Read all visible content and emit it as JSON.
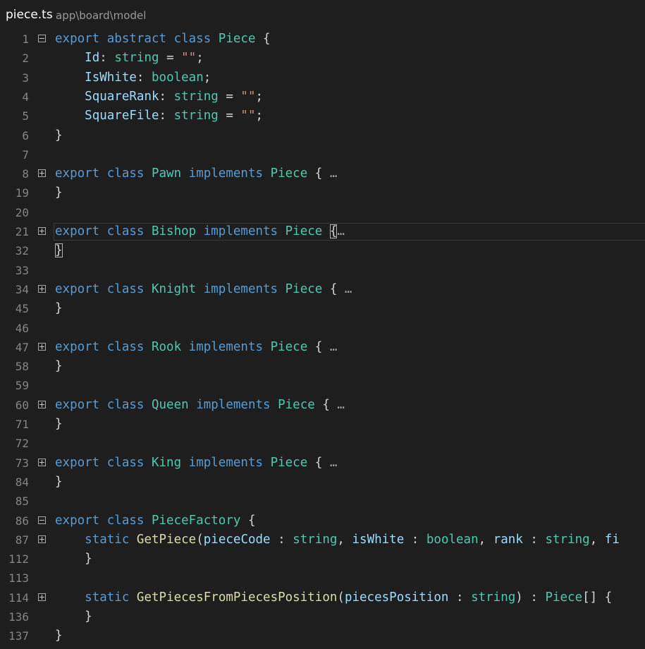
{
  "tab": {
    "file_name": "piece.ts",
    "path": "app\\board\\model"
  },
  "editor": {
    "lines": [
      {
        "num": "1",
        "fold": "minus",
        "tokens": [
          [
            "k",
            "export abstract class "
          ],
          [
            "t",
            "Piece"
          ],
          [
            "o",
            " {"
          ]
        ]
      },
      {
        "num": "2",
        "tokens": [
          [
            "o",
            "    "
          ],
          [
            "p",
            "Id"
          ],
          [
            "o",
            ": "
          ],
          [
            "t",
            "string"
          ],
          [
            "o",
            " = "
          ],
          [
            "s",
            "\"\""
          ],
          [
            "o",
            ";"
          ]
        ]
      },
      {
        "num": "3",
        "tokens": [
          [
            "o",
            "    "
          ],
          [
            "p",
            "IsWhite"
          ],
          [
            "o",
            ": "
          ],
          [
            "t",
            "boolean"
          ],
          [
            "o",
            ";"
          ]
        ]
      },
      {
        "num": "4",
        "tokens": [
          [
            "o",
            "    "
          ],
          [
            "p",
            "SquareRank"
          ],
          [
            "o",
            ": "
          ],
          [
            "t",
            "string"
          ],
          [
            "o",
            " = "
          ],
          [
            "s",
            "\"\""
          ],
          [
            "o",
            ";"
          ]
        ]
      },
      {
        "num": "5",
        "tokens": [
          [
            "o",
            "    "
          ],
          [
            "p",
            "SquareFile"
          ],
          [
            "o",
            ": "
          ],
          [
            "t",
            "string"
          ],
          [
            "o",
            " = "
          ],
          [
            "s",
            "\"\""
          ],
          [
            "o",
            ";"
          ]
        ]
      },
      {
        "num": "6",
        "tokens": [
          [
            "o",
            "}"
          ]
        ]
      },
      {
        "num": "7",
        "tokens": []
      },
      {
        "num": "8",
        "fold": "plus",
        "tokens": [
          [
            "k",
            "export class "
          ],
          [
            "t",
            "Pawn"
          ],
          [
            "k",
            " implements "
          ],
          [
            "t",
            "Piece"
          ],
          [
            "o",
            " { "
          ],
          [
            "ellipsis",
            "…"
          ]
        ]
      },
      {
        "num": "19",
        "tokens": [
          [
            "o",
            "}"
          ]
        ]
      },
      {
        "num": "20",
        "tokens": []
      },
      {
        "num": "21",
        "fold": "plus",
        "current": true,
        "tokens": [
          [
            "k",
            "export class "
          ],
          [
            "t",
            "Bishop"
          ],
          [
            "k",
            " implements "
          ],
          [
            "t",
            "Piece"
          ],
          [
            "o",
            " "
          ],
          [
            "bm",
            "{"
          ],
          [
            "ellipsis",
            "…"
          ]
        ]
      },
      {
        "num": "32",
        "tokens": [
          [
            "bm",
            "}"
          ]
        ]
      },
      {
        "num": "33",
        "tokens": []
      },
      {
        "num": "34",
        "fold": "plus",
        "tokens": [
          [
            "k",
            "export class "
          ],
          [
            "t",
            "Knight"
          ],
          [
            "k",
            " implements "
          ],
          [
            "t",
            "Piece"
          ],
          [
            "o",
            " { "
          ],
          [
            "ellipsis",
            "…"
          ]
        ]
      },
      {
        "num": "45",
        "tokens": [
          [
            "o",
            "}"
          ]
        ]
      },
      {
        "num": "46",
        "tokens": []
      },
      {
        "num": "47",
        "fold": "plus",
        "tokens": [
          [
            "k",
            "export class "
          ],
          [
            "t",
            "Rook"
          ],
          [
            "k",
            " implements "
          ],
          [
            "t",
            "Piece"
          ],
          [
            "o",
            " { "
          ],
          [
            "ellipsis",
            "…"
          ]
        ]
      },
      {
        "num": "58",
        "tokens": [
          [
            "o",
            "}"
          ]
        ]
      },
      {
        "num": "59",
        "tokens": []
      },
      {
        "num": "60",
        "fold": "plus",
        "tokens": [
          [
            "k",
            "export class "
          ],
          [
            "t",
            "Queen"
          ],
          [
            "k",
            " implements "
          ],
          [
            "t",
            "Piece"
          ],
          [
            "o",
            " { "
          ],
          [
            "ellipsis",
            "…"
          ]
        ]
      },
      {
        "num": "71",
        "tokens": [
          [
            "o",
            "}"
          ]
        ]
      },
      {
        "num": "72",
        "tokens": []
      },
      {
        "num": "73",
        "fold": "plus",
        "tokens": [
          [
            "k",
            "export class "
          ],
          [
            "t",
            "King"
          ],
          [
            "k",
            " implements "
          ],
          [
            "t",
            "Piece"
          ],
          [
            "o",
            " { "
          ],
          [
            "ellipsis",
            "…"
          ]
        ]
      },
      {
        "num": "84",
        "tokens": [
          [
            "o",
            "}"
          ]
        ]
      },
      {
        "num": "85",
        "tokens": []
      },
      {
        "num": "86",
        "fold": "minus",
        "tokens": [
          [
            "k",
            "export class "
          ],
          [
            "t",
            "PieceFactory"
          ],
          [
            "o",
            " {"
          ]
        ]
      },
      {
        "num": "87",
        "fold": "plus",
        "tokens": [
          [
            "o",
            "    "
          ],
          [
            "k",
            "static "
          ],
          [
            "f",
            "GetPiece"
          ],
          [
            "o",
            "("
          ],
          [
            "p",
            "pieceCode"
          ],
          [
            "o",
            " : "
          ],
          [
            "t",
            "string"
          ],
          [
            "o",
            ", "
          ],
          [
            "p",
            "isWhite"
          ],
          [
            "o",
            " : "
          ],
          [
            "t",
            "boolean"
          ],
          [
            "o",
            ", "
          ],
          [
            "p",
            "rank"
          ],
          [
            "o",
            " : "
          ],
          [
            "t",
            "string"
          ],
          [
            "o",
            ", "
          ],
          [
            "p",
            "fi"
          ]
        ]
      },
      {
        "num": "112",
        "tokens": [
          [
            "o",
            "    }"
          ]
        ]
      },
      {
        "num": "113",
        "tokens": []
      },
      {
        "num": "114",
        "fold": "plus",
        "tokens": [
          [
            "o",
            "    "
          ],
          [
            "k",
            "static "
          ],
          [
            "f",
            "GetPiecesFromPiecesPosition"
          ],
          [
            "o",
            "("
          ],
          [
            "p",
            "piecesPosition"
          ],
          [
            "o",
            " : "
          ],
          [
            "t",
            "string"
          ],
          [
            "o",
            ") : "
          ],
          [
            "t",
            "Piece"
          ],
          [
            "o",
            "[] {"
          ]
        ]
      },
      {
        "num": "136",
        "tokens": [
          [
            "o",
            "    }"
          ]
        ]
      },
      {
        "num": "137",
        "tokens": [
          [
            "o",
            "}"
          ]
        ]
      }
    ]
  }
}
